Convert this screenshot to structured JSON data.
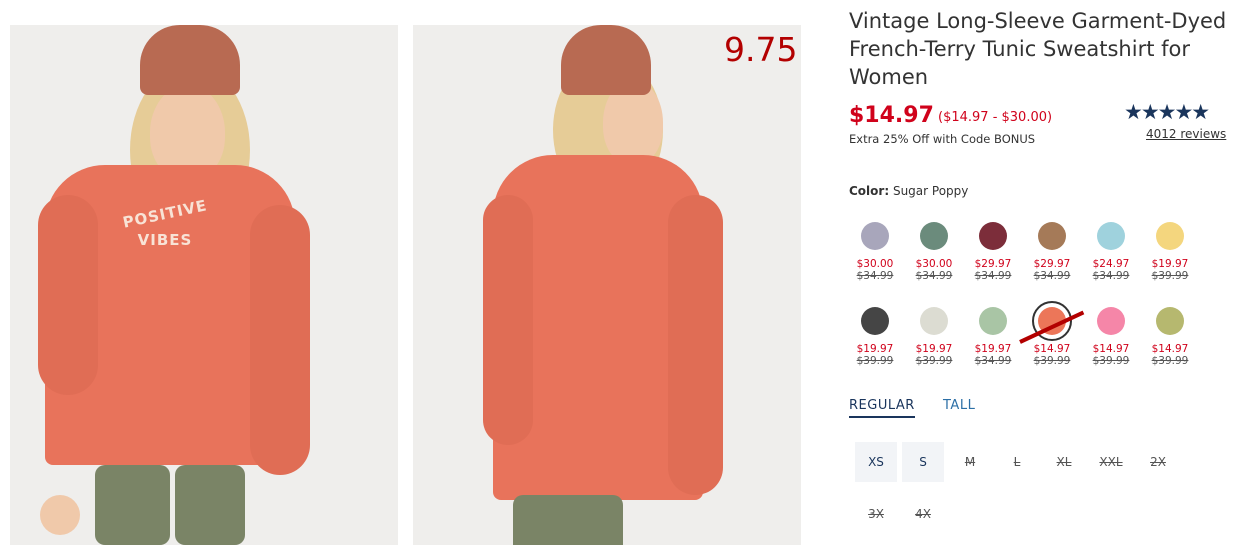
{
  "photos": {
    "front_print_line1": "POSITIVE",
    "front_print_line2": "VIBES"
  },
  "annotation": {
    "price": "9.75"
  },
  "product": {
    "title": "Vintage Long-Sleeve Garment-Dyed French-Terry Tunic Sweatshirt for Women",
    "sale_price": "$14.97",
    "price_range": "($14.97 - $30.00)",
    "promo": "Extra 25% Off with Code BONUS",
    "stars": "★★★★★",
    "reviews": "4012 reviews"
  },
  "color": {
    "label": "Color:",
    "value": "Sugar Poppy"
  },
  "swatches": [
    {
      "color": "#a8a6bb",
      "now": "$30.00",
      "was": "$34.99"
    },
    {
      "color": "#6b8b7c",
      "now": "$30.00",
      "was": "$34.99"
    },
    {
      "color": "#7c2d3a",
      "now": "$29.97",
      "was": "$34.99"
    },
    {
      "color": "#a57a58",
      "now": "$29.97",
      "was": "$34.99"
    },
    {
      "color": "#9fd2dd",
      "now": "$24.97",
      "was": "$34.99"
    },
    {
      "color": "#f4d67e",
      "now": "$19.97",
      "was": "$39.99"
    },
    {
      "color": "#454545",
      "now": "$19.97",
      "was": "$39.99"
    },
    {
      "color": "#dcdcd2",
      "now": "$19.97",
      "was": "$39.99"
    },
    {
      "color": "#a9c5a5",
      "now": "$19.97",
      "was": "$34.99"
    },
    {
      "color": "#ec7659",
      "now": "$14.97",
      "was": "$39.99"
    },
    {
      "color": "#f586a8",
      "now": "$14.97",
      "was": "$39.99"
    },
    {
      "color": "#b6b86f",
      "now": "$14.97",
      "was": "$39.99"
    }
  ],
  "fit": {
    "regular": "REGULAR",
    "tall": "TALL"
  },
  "sizes": [
    "XS",
    "S",
    "M",
    "L",
    "XL",
    "XXL",
    "2X",
    "3X",
    "4X"
  ]
}
